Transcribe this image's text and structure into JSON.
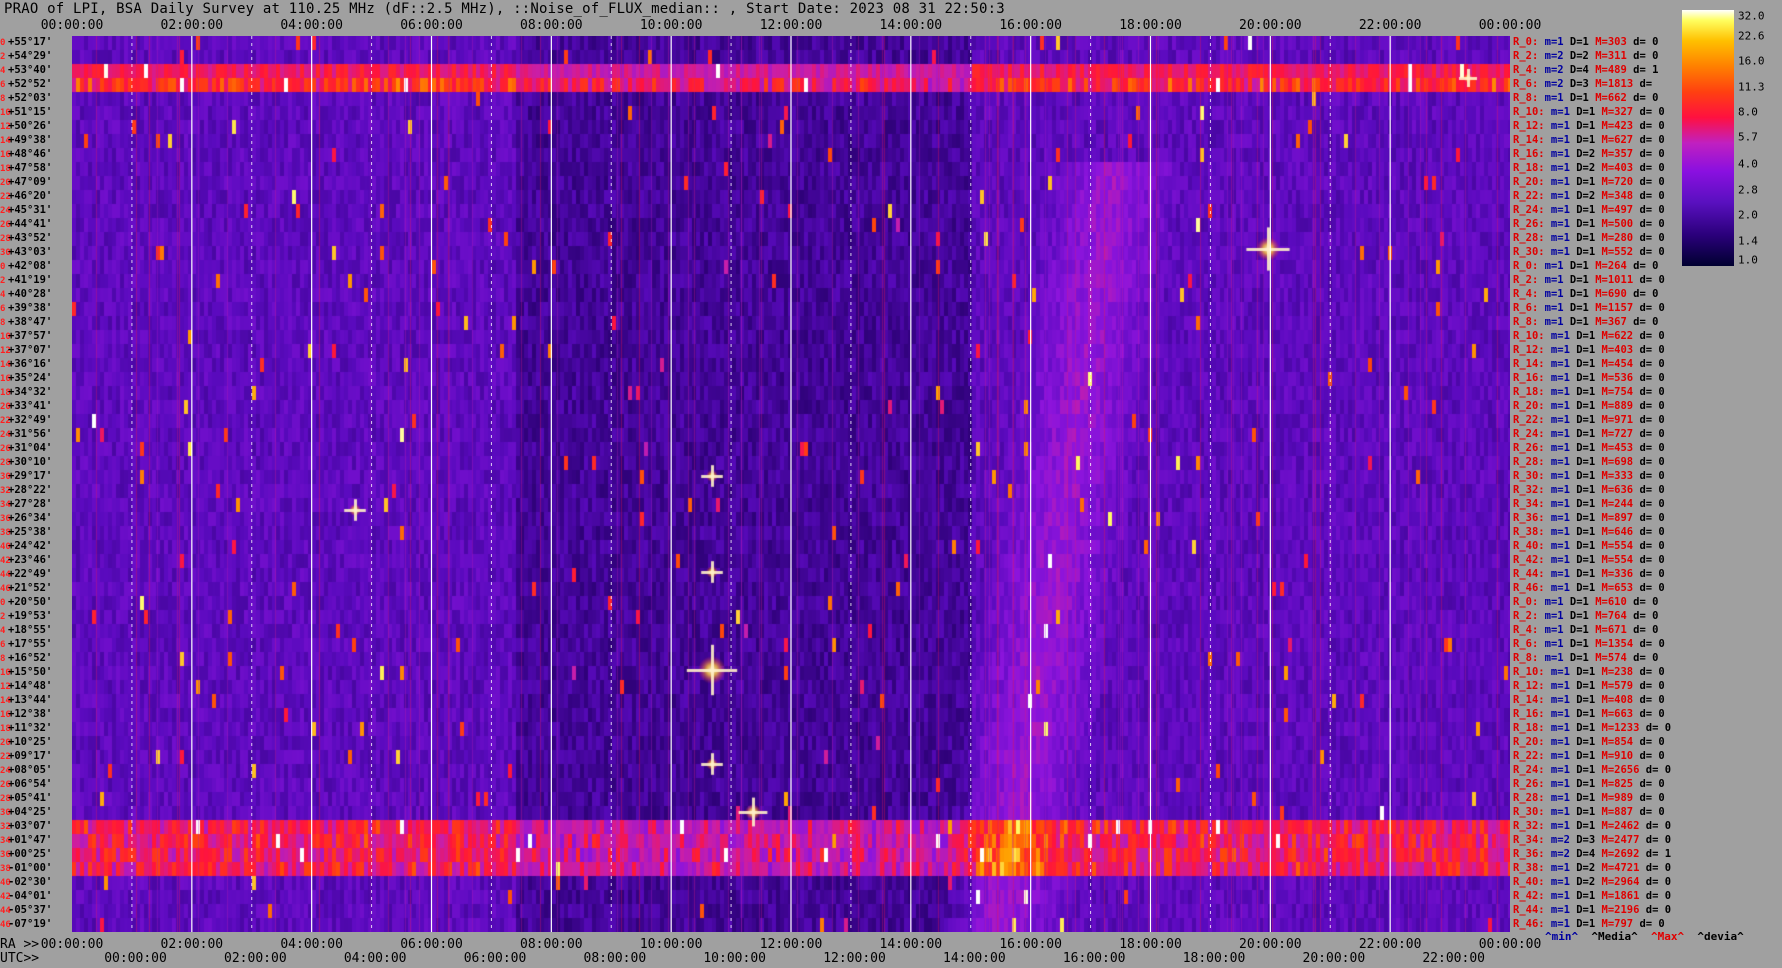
{
  "title": "PRAO of LPI, BSA Daily Survey at 110.25 MHz (dF::2.5 MHz), ::Noise_of_FLUX_median:: , Start Date: 2023 08 31 22:50:3",
  "chart_data": {
    "type": "heatmap",
    "time_axis_top": [
      "00:00:00",
      "02:00:00",
      "04:00:00",
      "06:00:00",
      "08:00:00",
      "10:00:00",
      "12:00:00",
      "14:00:00",
      "16:00:00",
      "18:00:00",
      "20:00:00",
      "22:00:00",
      "00:00:00"
    ],
    "ra_axis_label": "RA >>",
    "ra_axis": [
      "00:00:00",
      "02:00:00",
      "04:00:00",
      "06:00:00",
      "08:00:00",
      "10:00:00",
      "12:00:00",
      "14:00:00",
      "16:00:00",
      "18:00:00",
      "20:00:00",
      "22:00:00",
      "00:00:00"
    ],
    "utc_axis_label": "UTC>>",
    "utc_axis": [
      "00:00:00",
      "02:00:00",
      "04:00:00",
      "06:00:00",
      "08:00:00",
      "10:00:00",
      "12:00:00",
      "14:00:00",
      "16:00:00",
      "18:00:00",
      "20:00:00",
      "22:00:00"
    ],
    "dec_labels": [
      "+55°17'",
      "+54°29'",
      "+53°40'",
      "+52°52'",
      "+52°03'",
      "+51°15'",
      "+50°26'",
      "+49°38'",
      "+48°46'",
      "+47°58'",
      "+47°09'",
      "+46°20'",
      "+45°31'",
      "+44°41'",
      "+43°52'",
      "+43°03'",
      "+42°08'",
      "+41°19'",
      "+40°28'",
      "+39°38'",
      "+38°47'",
      "+37°57'",
      "+37°07'",
      "+36°16'",
      "+35°24'",
      "+34°32'",
      "+33°41'",
      "+32°49'",
      "+31°56'",
      "+31°04'",
      "+30°10'",
      "+29°17'",
      "+28°22'",
      "+27°28'",
      "+26°34'",
      "+25°38'",
      "+24°42'",
      "+23°46'",
      "+22°49'",
      "+21°52'",
      "+20°50'",
      "+19°53'",
      "+18°55'",
      "+17°55'",
      "+16°52'",
      "+15°50'",
      "+14°48'",
      "+13°44'",
      "+12°38'",
      "+11°32'",
      "+10°25'",
      "+09°17'",
      "+08°05'",
      "+06°54'",
      "+05°41'",
      "+04°25'",
      "+03°07'",
      "+01°47'",
      "+00°25'",
      "-01°00'",
      "-02°30'",
      "-04°01'",
      "-05°37'",
      "-07°19'"
    ],
    "dec_index": [
      "0",
      "2",
      "4",
      "6",
      "8",
      "10",
      "12",
      "14",
      "16",
      "18",
      "20",
      "22",
      "24",
      "26",
      "28",
      "30",
      "0",
      "2",
      "4",
      "6",
      "8",
      "10",
      "12",
      "14",
      "16",
      "18",
      "20",
      "22",
      "24",
      "26",
      "28",
      "30",
      "32",
      "34",
      "36",
      "38",
      "40",
      "42",
      "44",
      "46",
      "0",
      "2",
      "4",
      "6",
      "8",
      "10",
      "12",
      "14",
      "16",
      "18",
      "20",
      "22",
      "24",
      "26",
      "28",
      "30",
      "32",
      "34",
      "36",
      "38",
      "40",
      "42",
      "44",
      "46"
    ],
    "stats": [
      {
        "r": "R_0:",
        "m": "1",
        "d": "1",
        "M": "303",
        "dv": "0"
      },
      {
        "r": "R_2:",
        "m": "2",
        "d": "2",
        "M": "311",
        "dv": "0"
      },
      {
        "r": "R_4:",
        "m": "2",
        "d": "4",
        "M": "489",
        "dv": "1"
      },
      {
        "r": "R_6:",
        "m": "2",
        "d": "3",
        "M": "1813",
        "dv": ""
      },
      {
        "r": "R_8:",
        "m": "1",
        "d": "1",
        "M": "662",
        "dv": "0"
      },
      {
        "r": "R_10:",
        "m": "1",
        "d": "1",
        "M": "327",
        "dv": "0"
      },
      {
        "r": "R_12:",
        "m": "1",
        "d": "1",
        "M": "423",
        "dv": "0"
      },
      {
        "r": "R_14:",
        "m": "1",
        "d": "1",
        "M": "627",
        "dv": "0"
      },
      {
        "r": "R_16:",
        "m": "1",
        "d": "2",
        "M": "357",
        "dv": "0"
      },
      {
        "r": "R_18:",
        "m": "1",
        "d": "2",
        "M": "403",
        "dv": "0"
      },
      {
        "r": "R_20:",
        "m": "1",
        "d": "1",
        "M": "720",
        "dv": "0"
      },
      {
        "r": "R_22:",
        "m": "1",
        "d": "2",
        "M": "348",
        "dv": "0"
      },
      {
        "r": "R_24:",
        "m": "1",
        "d": "1",
        "M": "497",
        "dv": "0"
      },
      {
        "r": "R_26:",
        "m": "1",
        "d": "1",
        "M": "500",
        "dv": "0"
      },
      {
        "r": "R_28:",
        "m": "1",
        "d": "1",
        "M": "280",
        "dv": "0"
      },
      {
        "r": "R_30:",
        "m": "1",
        "d": "1",
        "M": "552",
        "dv": "0"
      },
      {
        "r": "R_0:",
        "m": "1",
        "d": "1",
        "M": "264",
        "dv": "0"
      },
      {
        "r": "R_2:",
        "m": "1",
        "d": "1",
        "M": "1011",
        "dv": "0"
      },
      {
        "r": "R_4:",
        "m": "1",
        "d": "1",
        "M": "690",
        "dv": "0"
      },
      {
        "r": "R_6:",
        "m": "1",
        "d": "1",
        "M": "1157",
        "dv": "0"
      },
      {
        "r": "R_8:",
        "m": "1",
        "d": "1",
        "M": "367",
        "dv": "0"
      },
      {
        "r": "R_10:",
        "m": "1",
        "d": "1",
        "M": "622",
        "dv": "0"
      },
      {
        "r": "R_12:",
        "m": "1",
        "d": "1",
        "M": "403",
        "dv": "0"
      },
      {
        "r": "R_14:",
        "m": "1",
        "d": "1",
        "M": "454",
        "dv": "0"
      },
      {
        "r": "R_16:",
        "m": "1",
        "d": "1",
        "M": "536",
        "dv": "0"
      },
      {
        "r": "R_18:",
        "m": "1",
        "d": "1",
        "M": "754",
        "dv": "0"
      },
      {
        "r": "R_20:",
        "m": "1",
        "d": "1",
        "M": "889",
        "dv": "0"
      },
      {
        "r": "R_22:",
        "m": "1",
        "d": "1",
        "M": "971",
        "dv": "0"
      },
      {
        "r": "R_24:",
        "m": "1",
        "d": "1",
        "M": "727",
        "dv": "0"
      },
      {
        "r": "R_26:",
        "m": "1",
        "d": "1",
        "M": "453",
        "dv": "0"
      },
      {
        "r": "R_28:",
        "m": "1",
        "d": "1",
        "M": "698",
        "dv": "0"
      },
      {
        "r": "R_30:",
        "m": "1",
        "d": "1",
        "M": "333",
        "dv": "0"
      },
      {
        "r": "R_32:",
        "m": "1",
        "d": "1",
        "M": "636",
        "dv": "0"
      },
      {
        "r": "R_34:",
        "m": "1",
        "d": "1",
        "M": "244",
        "dv": "0"
      },
      {
        "r": "R_36:",
        "m": "1",
        "d": "1",
        "M": "897",
        "dv": "0"
      },
      {
        "r": "R_38:",
        "m": "1",
        "d": "1",
        "M": "646",
        "dv": "0"
      },
      {
        "r": "R_40:",
        "m": "1",
        "d": "1",
        "M": "554",
        "dv": "0"
      },
      {
        "r": "R_42:",
        "m": "1",
        "d": "1",
        "M": "554",
        "dv": "0"
      },
      {
        "r": "R_44:",
        "m": "1",
        "d": "1",
        "M": "336",
        "dv": "0"
      },
      {
        "r": "R_46:",
        "m": "1",
        "d": "1",
        "M": "653",
        "dv": "0"
      },
      {
        "r": "R_0:",
        "m": "1",
        "d": "1",
        "M": "610",
        "dv": "0"
      },
      {
        "r": "R_2:",
        "m": "1",
        "d": "1",
        "M": "764",
        "dv": "0"
      },
      {
        "r": "R_4:",
        "m": "1",
        "d": "1",
        "M": "671",
        "dv": "0"
      },
      {
        "r": "R_6:",
        "m": "1",
        "d": "1",
        "M": "1354",
        "dv": "0"
      },
      {
        "r": "R_8:",
        "m": "1",
        "d": "1",
        "M": "574",
        "dv": "0"
      },
      {
        "r": "R_10:",
        "m": "1",
        "d": "1",
        "M": "238",
        "dv": "0"
      },
      {
        "r": "R_12:",
        "m": "1",
        "d": "1",
        "M": "579",
        "dv": "0"
      },
      {
        "r": "R_14:",
        "m": "1",
        "d": "1",
        "M": "408",
        "dv": "0"
      },
      {
        "r": "R_16:",
        "m": "1",
        "d": "1",
        "M": "663",
        "dv": "0"
      },
      {
        "r": "R_18:",
        "m": "1",
        "d": "1",
        "M": "1233",
        "dv": "0"
      },
      {
        "r": "R_20:",
        "m": "1",
        "d": "1",
        "M": "854",
        "dv": "0"
      },
      {
        "r": "R_22:",
        "m": "1",
        "d": "1",
        "M": "910",
        "dv": "0"
      },
      {
        "r": "R_24:",
        "m": "1",
        "d": "1",
        "M": "2656",
        "dv": "0"
      },
      {
        "r": "R_26:",
        "m": "1",
        "d": "1",
        "M": "825",
        "dv": "0"
      },
      {
        "r": "R_28:",
        "m": "1",
        "d": "1",
        "M": "989",
        "dv": "0"
      },
      {
        "r": "R_30:",
        "m": "1",
        "d": "1",
        "M": "887",
        "dv": "0"
      },
      {
        "r": "R_32:",
        "m": "1",
        "d": "1",
        "M": "2462",
        "dv": "0"
      },
      {
        "r": "R_34:",
        "m": "2",
        "d": "3",
        "M": "2477",
        "dv": "0"
      },
      {
        "r": "R_36:",
        "m": "2",
        "d": "4",
        "M": "2692",
        "dv": "1"
      },
      {
        "r": "R_38:",
        "m": "1",
        "d": "2",
        "M": "4721",
        "dv": "0"
      },
      {
        "r": "R_40:",
        "m": "1",
        "d": "2",
        "M": "2964",
        "dv": "0"
      },
      {
        "r": "R_42:",
        "m": "1",
        "d": "1",
        "M": "1861",
        "dv": "0"
      },
      {
        "r": "R_44:",
        "m": "1",
        "d": "1",
        "M": "2196",
        "dv": "0"
      },
      {
        "r": "R_46:",
        "m": "1",
        "d": "1",
        "M": "797",
        "dv": "0"
      }
    ],
    "stats_legend": {
      "min": "^min^",
      "median": "^Media^",
      "max": "^Max^",
      "devia": "^devia^"
    },
    "colorbar": {
      "ticks": [
        32.0,
        22.6,
        16.0,
        11.3,
        8.0,
        5.7,
        4.0,
        2.8,
        2.0,
        1.4,
        1.0
      ],
      "tick_labels": [
        "32.0",
        "22.6",
        "16.0",
        "11.3",
        "8.0",
        "5.7",
        "4.0",
        "2.8",
        "2.0",
        "1.4",
        "1.0"
      ],
      "scale": "log"
    },
    "grid": true
  },
  "colors": {
    "background": "#a0a0a0",
    "plot_bg": "#120024",
    "label_red": "#e00000",
    "label_blue": "#0000a0",
    "grid_line": "#ffffff"
  }
}
